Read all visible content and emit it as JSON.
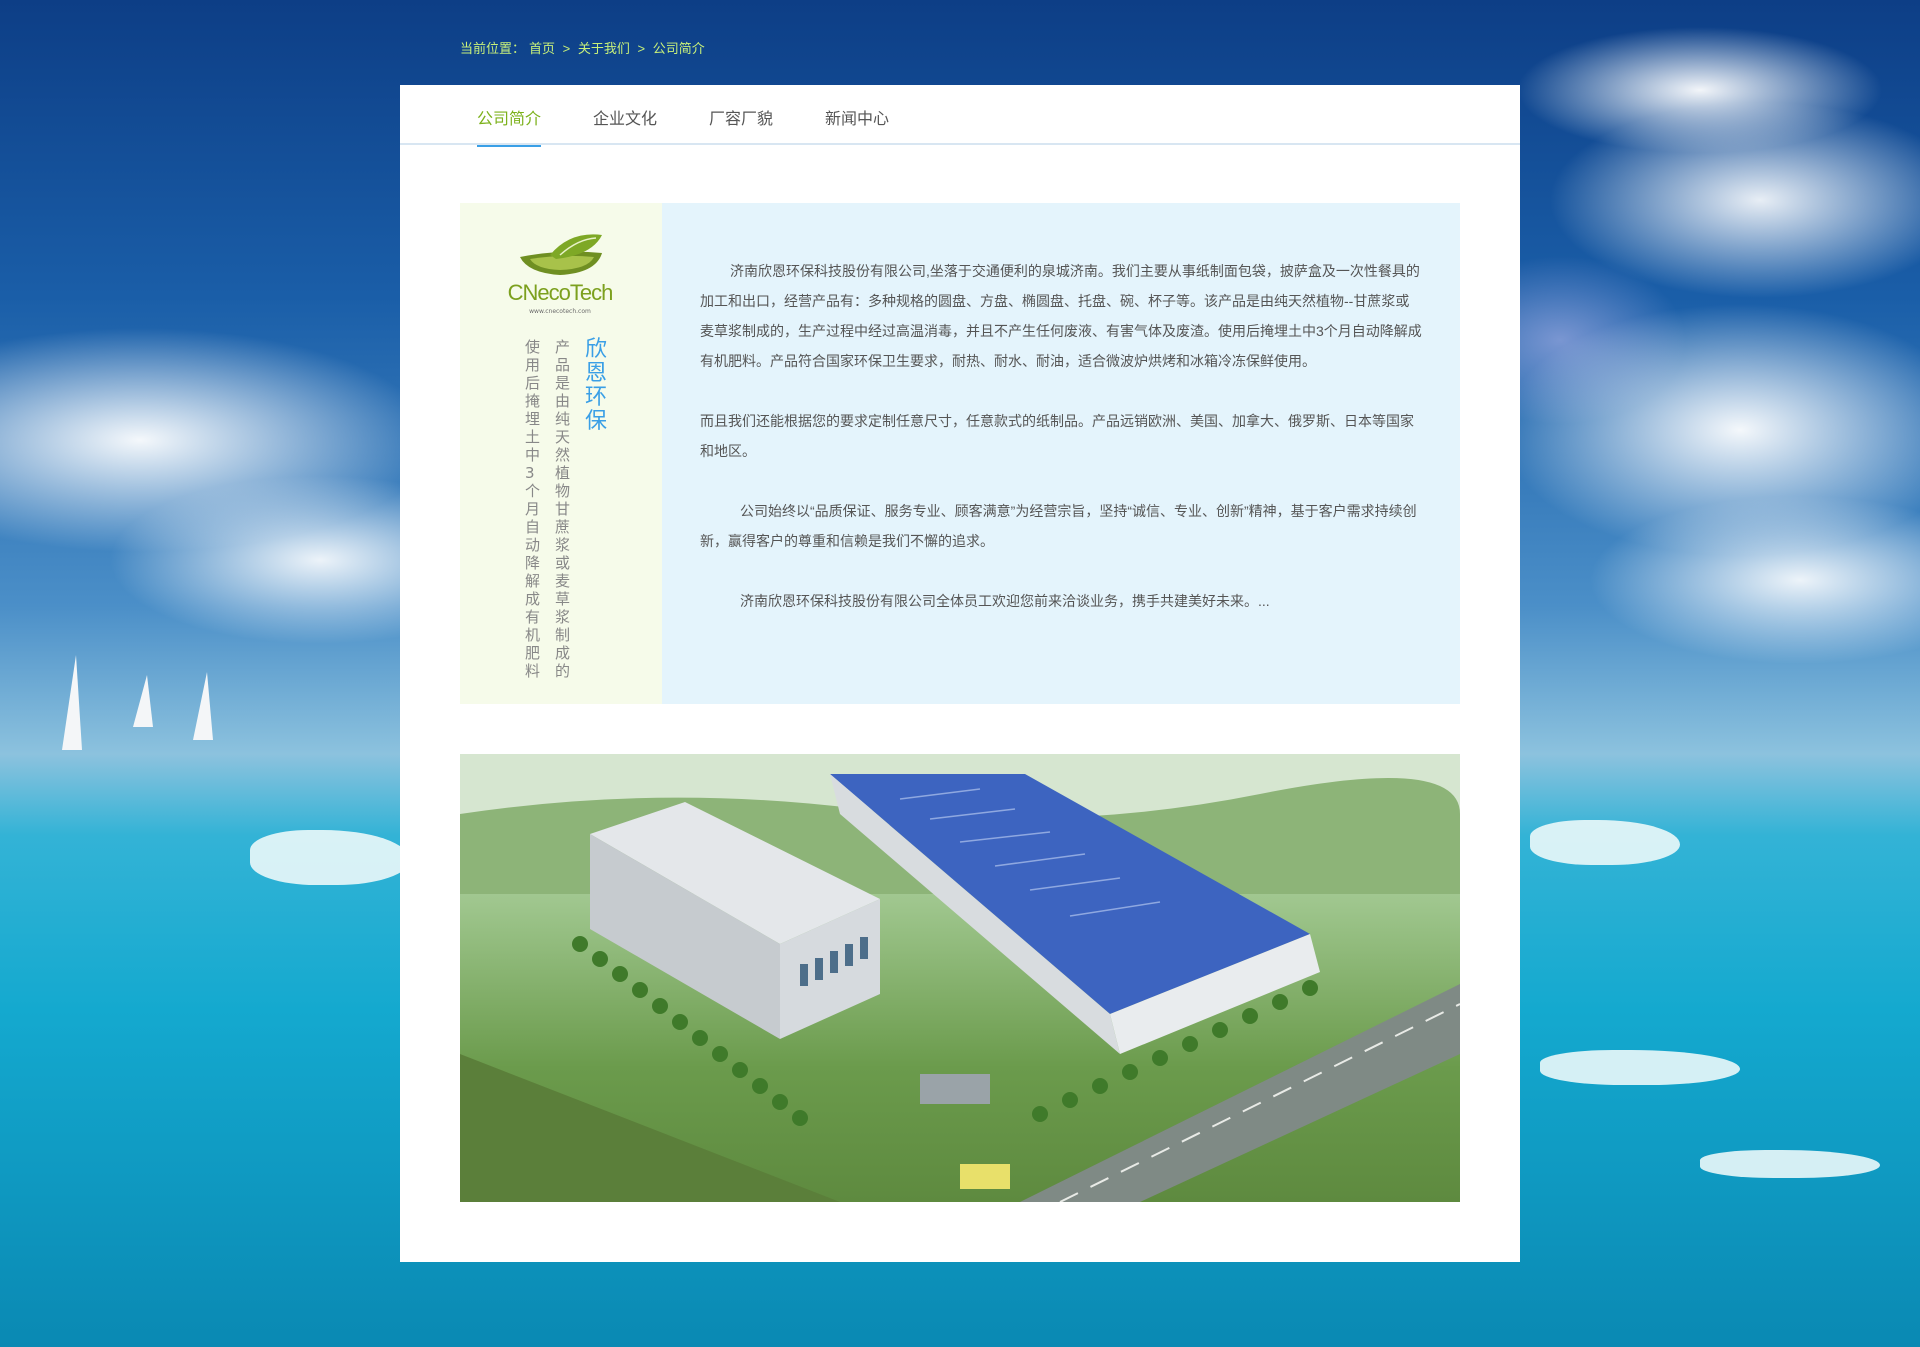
{
  "breadcrumb": {
    "label": "当前位置：",
    "home": "首页",
    "sep1": ">",
    "about": "关于我们",
    "sep2": ">",
    "current": "公司简介"
  },
  "tabs": [
    {
      "label": "公司简介",
      "active": true
    },
    {
      "label": "企业文化",
      "active": false
    },
    {
      "label": "厂容厂貌",
      "active": false
    },
    {
      "label": "新闻中心",
      "active": false
    }
  ],
  "logo": {
    "text": "CNecoTech",
    "sub": "www.cnecotech.com"
  },
  "side": {
    "title": "欣恩环保",
    "col1": "产品是由纯天然植物甘蔗浆或麦草浆制成的",
    "col2": "使用后掩埋土中3个月自动降解成有机肥料"
  },
  "intro": {
    "p1": "济南欣恩环保科技股份有限公司,坐落于交通便利的泉城济南。我们主要从事纸制面包袋，披萨盒及一次性餐具的加工和出口，经营产品有：多种规格的圆盘、方盘、椭圆盘、托盘、碗、杯子等。该产品是由纯天然植物--甘蔗浆或麦草浆制成的，生产过程中经过高温消毒，并且不产生任何废液、有害气体及废渣。使用后掩埋土中3个月自动降解成有机肥料。产品符合国家环保卫生要求，耐热、耐水、耐油，适合微波炉烘烤和冰箱冷冻保鲜使用。",
    "p2": "而且我们还能根据您的要求定制任意尺寸，任意款式的纸制品。产品远销欧洲、美国、加拿大、俄罗斯、日本等国家和地区。",
    "p3": "公司始终以“品质保证、服务专业、顾客满意”为经营宗旨，坚持“诚信、专业、创新”精神，基于客户需求持续创新，赢得客户的尊重和信赖是我们不懈的追求。",
    "p4": "济南欣恩环保科技股份有限公司全体员工欢迎您前来洽谈业务，携手共建美好未来。..."
  },
  "colors": {
    "breadcrumb": "#c8f07a",
    "tab_active": "#7cb11b",
    "tab_underline": "#3a9fe6",
    "side_bg": "#f6fbea",
    "text_bg": "#e4f4fc",
    "title_blue": "#3a9fe6"
  }
}
